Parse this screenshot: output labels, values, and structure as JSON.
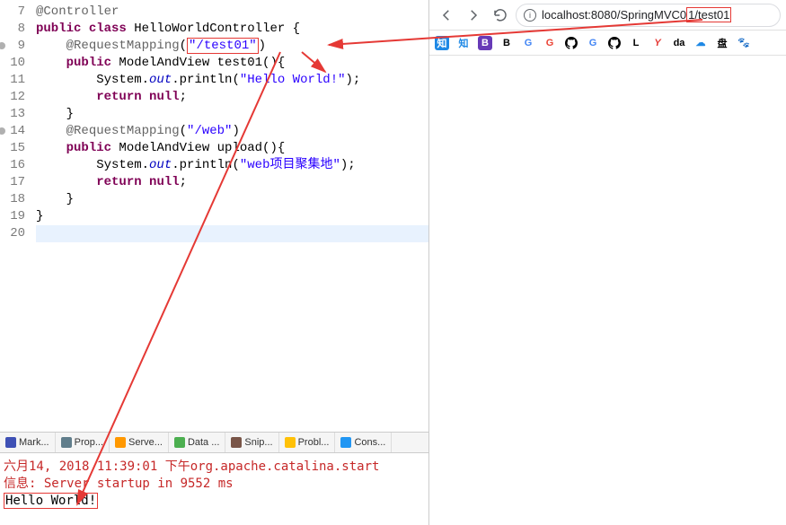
{
  "code": {
    "lines": [
      {
        "n": 7,
        "seg": [
          {
            "t": "@Controller",
            "c": "ann"
          }
        ]
      },
      {
        "n": 8,
        "seg": [
          {
            "t": "public",
            "c": "kw"
          },
          {
            "t": " "
          },
          {
            "t": "class",
            "c": "kw"
          },
          {
            "t": " HelloWorldController {"
          }
        ]
      },
      {
        "n": 9,
        "dot": true,
        "seg": [
          {
            "t": "    "
          },
          {
            "t": "@RequestMapping",
            "c": "ann"
          },
          {
            "t": "("
          },
          {
            "t": "\"/test01\"",
            "c": "str",
            "box": true
          },
          {
            "t": ")"
          }
        ]
      },
      {
        "n": 10,
        "seg": [
          {
            "t": "    "
          },
          {
            "t": "public",
            "c": "kw"
          },
          {
            "t": " ModelAndView test01(){"
          }
        ]
      },
      {
        "n": 11,
        "seg": [
          {
            "t": "        System."
          },
          {
            "t": "out",
            "c": "stat"
          },
          {
            "t": ".println("
          },
          {
            "t": "\"Hello World!\"",
            "c": "str"
          },
          {
            "t": ");"
          }
        ]
      },
      {
        "n": 12,
        "seg": [
          {
            "t": "        "
          },
          {
            "t": "return",
            "c": "kw"
          },
          {
            "t": " "
          },
          {
            "t": "null",
            "c": "kw"
          },
          {
            "t": ";"
          }
        ]
      },
      {
        "n": 13,
        "seg": [
          {
            "t": "    }"
          }
        ]
      },
      {
        "n": 14,
        "dot": true,
        "seg": [
          {
            "t": "    "
          },
          {
            "t": "@RequestMapping",
            "c": "ann"
          },
          {
            "t": "("
          },
          {
            "t": "\"/web\"",
            "c": "str"
          },
          {
            "t": ")"
          }
        ]
      },
      {
        "n": 15,
        "seg": [
          {
            "t": "    "
          },
          {
            "t": "public",
            "c": "kw"
          },
          {
            "t": " ModelAndView upload(){"
          }
        ]
      },
      {
        "n": 16,
        "seg": [
          {
            "t": "        System."
          },
          {
            "t": "out",
            "c": "stat"
          },
          {
            "t": ".println("
          },
          {
            "t": "\"web项目聚集地\"",
            "c": "str"
          },
          {
            "t": ");"
          }
        ]
      },
      {
        "n": 17,
        "seg": [
          {
            "t": "        "
          },
          {
            "t": "return",
            "c": "kw"
          },
          {
            "t": " "
          },
          {
            "t": "null",
            "c": "kw"
          },
          {
            "t": ";"
          }
        ]
      },
      {
        "n": 18,
        "seg": [
          {
            "t": "    }"
          }
        ]
      },
      {
        "n": 19,
        "seg": [
          {
            "t": "}"
          }
        ]
      },
      {
        "n": 20,
        "hl": true,
        "seg": [
          {
            "t": " "
          }
        ]
      }
    ]
  },
  "tabs": [
    {
      "label": "Mark...",
      "color": "#3f51b5"
    },
    {
      "label": "Prop...",
      "color": "#607d8b"
    },
    {
      "label": "Serve...",
      "color": "#ff9800"
    },
    {
      "label": "Data ...",
      "color": "#4caf50"
    },
    {
      "label": "Snip...",
      "color": "#795548"
    },
    {
      "label": "Probl...",
      "color": "#ffc107"
    },
    {
      "label": "Cons...",
      "color": "#2196f3"
    }
  ],
  "console": {
    "line1": "六月14, 2018 11:39:01 下午org.apache.catalina.start",
    "line2": "信息: Server startup in 9552 ms",
    "line3": "Hello World!"
  },
  "browser": {
    "url_prefix": "localhost:8080/SpringMVC0",
    "url_highlight": "1/test01",
    "bookmarks": [
      {
        "label": "知",
        "bg": "#1e88e5",
        "fg": "#fff"
      },
      {
        "label": "知",
        "bg": "#fff",
        "fg": "#1e88e5"
      },
      {
        "label": "B",
        "bg": "#673ab7",
        "fg": "#fff"
      },
      {
        "label": "B",
        "bg": "#fff",
        "fg": "#000"
      },
      {
        "label": "G",
        "bg": "#fff",
        "fg": "#4285f4"
      },
      {
        "label": "G",
        "bg": "#fff",
        "fg": "#ea4335"
      },
      {
        "label": "G",
        "bg": "#fff",
        "fg": "#000",
        "gh": true
      },
      {
        "label": "G",
        "bg": "#fff",
        "fg": "#4285f4"
      },
      {
        "label": "G",
        "bg": "#fff",
        "fg": "#000",
        "gh": true
      },
      {
        "label": "L",
        "bg": "#fff",
        "fg": "#000"
      },
      {
        "label": "Y",
        "bg": "#fff",
        "fg": "#e53935",
        "it": true
      },
      {
        "label": "da",
        "bg": "#fff",
        "fg": "#000"
      },
      {
        "label": "☁",
        "bg": "#fff",
        "fg": "#1e88e5"
      },
      {
        "label": "盘",
        "bg": "#fff",
        "fg": "#000"
      },
      {
        "label": "🐾",
        "bg": "#fff",
        "fg": "#1e88e5"
      }
    ]
  }
}
